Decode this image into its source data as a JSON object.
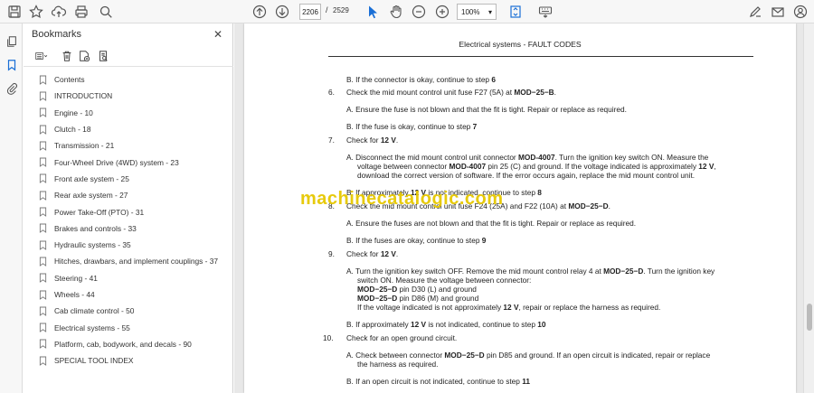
{
  "toolbar": {
    "current_page": "2206",
    "page_separator": "/",
    "total_pages": "2529",
    "zoom": "100%",
    "zoom_caret": "▾"
  },
  "panel": {
    "title": "Bookmarks",
    "close": "✕"
  },
  "bookmarks": [
    "Contents",
    "INTRODUCTION",
    "Engine - 10",
    "Clutch - 18",
    "Transmission - 21",
    "Four-Wheel Drive (4WD) system - 23",
    "Front axle system - 25",
    "Rear axle system - 27",
    "Power Take-Off (PTO) - 31",
    "Brakes and controls - 33",
    "Hydraulic systems - 35",
    "Hitches, drawbars, and implement couplings - 37",
    "Steering - 41",
    "Wheels - 44",
    "Cab climate control - 50",
    "Electrical systems - 55",
    "Platform, cab, bodywork, and decals - 90",
    "SPECIAL TOOL INDEX"
  ],
  "document": {
    "header": "Electrical systems - FAULT CODES",
    "watermark": "machinecatalogic.com",
    "lines": {
      "l1": "B.  If the connector is okay, continue to step 6",
      "n6": "6.",
      "l2": "Check the mid mount control unit fuse F27 (5A) at MOD−25−B.",
      "l3": "A.  Ensure the fuse is not blown and that the fit is tight.  Repair or replace as required.",
      "l4": "B.  If the fuse is okay, continue to step 7",
      "n7": "7.",
      "l5": "Check for 12 V.",
      "l6": "A.  Disconnect the mid mount control unit connector MOD-4007.  Turn the ignition key switch ON. Measure the",
      "l7": "voltage between connector MOD-4007 pin 25 (C) and ground.  If the voltage indicated is approximately 12 V,",
      "l8": "download the correct version of software.  If the error occurs again, replace the mid mount control unit.",
      "l9": "B.  If approximately 12 V is not indicated, continue to step 8",
      "n8": "8.",
      "l10": "Check the mid mount control unit fuse F24 (25A) and F22 (10A) at MOD−25−D.",
      "l11": "A.  Ensure the fuses are not blown and that the fit is tight.  Repair or replace as required.",
      "l12": "B.  If the fuses are okay, continue to step 9",
      "n9": "9.",
      "l13": "Check for 12 V.",
      "l14": "A.  Turn the ignition key switch OFF. Remove the mid mount control relay 4 at MOD−25−D. Turn the ignition key",
      "l15": "switch ON.  Measure the voltage between connector:",
      "l16": "MOD−25−D pin D30 (L) and ground",
      "l17": "MOD−25−D pin D86 (M) and ground",
      "l18": "If the voltage indicated is not approximately 12 V, repair or replace the harness as required.",
      "l19": "B.  If approximately 12 V is not indicated, continue to step 10",
      "n10": "10.",
      "l20": "Check for an open ground circuit.",
      "l21": "A.  Check between connector MOD−25−D pin D85 and ground.  If an open circuit is indicated, repair or replace",
      "l22": "the harness as required.",
      "l23": "B.  If an open circuit is not indicated, continue to step 11"
    }
  }
}
